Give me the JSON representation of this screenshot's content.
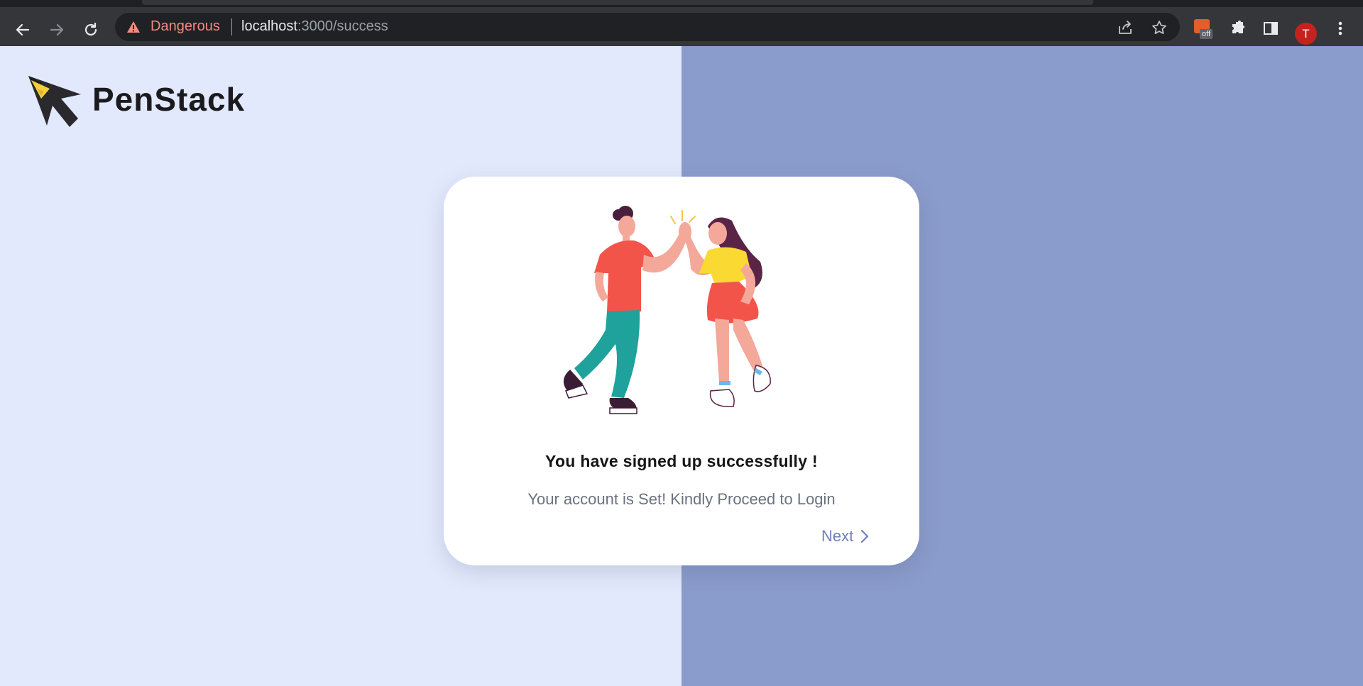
{
  "browser": {
    "security_label": "Dangerous",
    "url_host": "localhost",
    "url_path": ":3000/success",
    "extension_badge": "off",
    "profile_initial": "T"
  },
  "brand": {
    "name": "PenStack"
  },
  "card": {
    "headline": "You have signed up successfully !",
    "subtext": "Your account is Set! Kindly Proceed to Login",
    "next_label": "Next"
  },
  "colors": {
    "left_background": "#e3e9fc",
    "right_background": "#8a9ccb",
    "accent": "#6f80bd",
    "logo_yellow": "#f4d03f",
    "logo_dark": "#2a2a2e"
  }
}
